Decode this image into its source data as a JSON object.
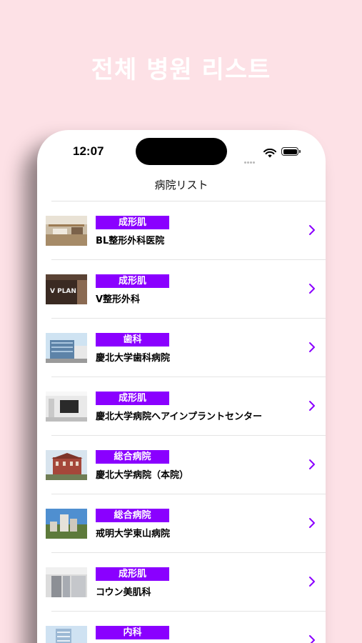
{
  "headline": "전체 병원 리스트",
  "status": {
    "time": "12:07"
  },
  "nav": {
    "title": "病院リスト"
  },
  "hospitals": [
    {
      "tag": "成形肌",
      "name": "BL整形外科医院",
      "thumb": "lobby"
    },
    {
      "tag": "成形肌",
      "name": "V整形外科",
      "thumb": "sign",
      "thumb_text": "V PLAN"
    },
    {
      "tag": "歯科",
      "name": "慶北大学歯科病院",
      "thumb": "building-blue"
    },
    {
      "tag": "成形肌",
      "name": "慶北大学病院ヘアインプラントセンター",
      "thumb": "interior"
    },
    {
      "tag": "総合病院",
      "name": "慶北大学病院（本院）",
      "thumb": "building-red"
    },
    {
      "tag": "総合病院",
      "name": "戒明大学東山病院",
      "thumb": "campus"
    },
    {
      "tag": "成形肌",
      "name": "コウン美肌科",
      "thumb": "corridor"
    },
    {
      "tag": "内科",
      "name": "",
      "thumb": "tower"
    }
  ],
  "colors": {
    "background": "#fde1e6",
    "tag": "#8a00ff",
    "chevron": "#8a00ff"
  }
}
